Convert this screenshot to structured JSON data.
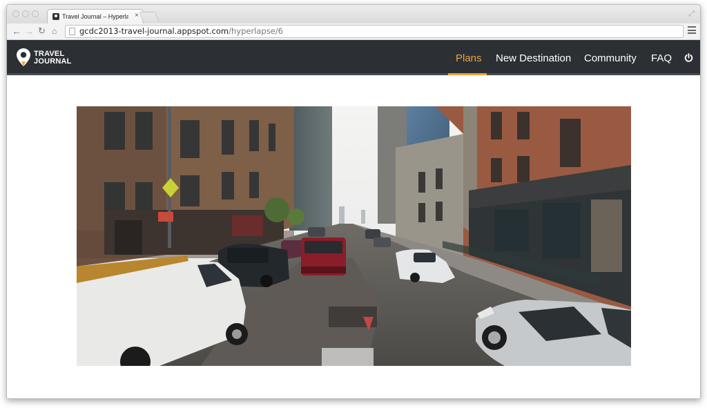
{
  "browser": {
    "tab_title": "Travel Journal – Hyperlapse",
    "tab_close": "×",
    "url_host": "gcdc2013-travel-journal.appspot.com",
    "url_path": "/hyperlapse/6",
    "icons": [
      "back-icon",
      "forward-icon",
      "reload-icon",
      "home-icon",
      "page-icon",
      "menu-icon",
      "restore-icon"
    ]
  },
  "header": {
    "logo_line1": "TRAVEL",
    "logo_line2": "JOURNAL",
    "nav": [
      {
        "label": "Plans",
        "active": true
      },
      {
        "label": "New Destination",
        "active": false
      },
      {
        "label": "Community",
        "active": false
      },
      {
        "label": "FAQ",
        "active": false
      }
    ],
    "accent_color": "#f0a33a",
    "header_bg": "#2c3034"
  },
  "main": {
    "viewer": "hyperlapse-street-view"
  }
}
